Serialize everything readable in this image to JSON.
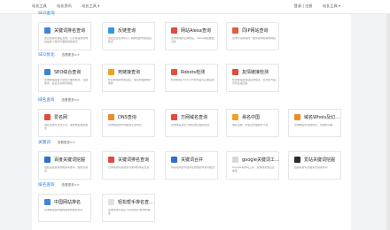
{
  "nav": {
    "left": [
      "站长工具",
      "站长资讯",
      "站长工具 ▾"
    ],
    "right": [
      "登录 | 注册",
      "站长工具 ▾"
    ]
  },
  "more_label": "查看更多>>",
  "sections": [
    {
      "title": "SEO查询",
      "cards": [
        {
          "name": "关键词排名查询",
          "desc": "通过关键词排名查询，可以快速找到网站在各个搜索引擎的排名情况",
          "color": "#3d86d8"
        },
        {
          "name": "反链查询",
          "desc": "通过反链查询可以了解网站的外部链接情况",
          "color": "#2f9ae0"
        },
        {
          "name": "网站Alexa查询",
          "desc": "查询网站的全球排名，Alexa排名数据分析",
          "color": "#e04a3a"
        },
        {
          "name": "同IP网站查询",
          "desc": "查询与该网站同一服务器IP的其他网站",
          "color": "#e45a3e"
        }
      ]
    },
    {
      "title": "SEO优化",
      "cards": [
        {
          "name": "SEO综合查询",
          "desc": "查询网站在各大搜索引擎的信息，包括收录、反链及关键词排名",
          "color": "#3b82d6"
        },
        {
          "name": "死链接查询",
          "desc": "检查网站中的死链接，提高网站的用户体验",
          "color": "#f0a020"
        },
        {
          "name": "Robots检测",
          "desc": "检测网站robots.txt文件是否正确设置",
          "color": "#e0503a"
        },
        {
          "name": "友情链接检测",
          "desc": "检测网站友情链接的情况，查询对方是否有链接回来",
          "color": "#e24a3c"
        }
      ]
    },
    {
      "title": "域名查询",
      "cards": [
        {
          "name": "爱名网",
          "desc": "域名注册及交易平台，提供域名相关服务",
          "color": "#e04a3a"
        },
        {
          "name": "DNS查询",
          "desc": "查询域名的DNS解析记录信息",
          "color": "#f08a24"
        },
        {
          "name": "万网域名查询",
          "desc": "查询域名是否已被注册及相关信息",
          "color": "#e24a3c"
        },
        {
          "name": "易名中国",
          "desc": "域名注册、交易及管理服务平台",
          "color": "#f0a020"
        },
        {
          "name": "域名Whois及幻...",
          "desc": "查询域名的注册信息、到期时间等",
          "color": "#f08a24"
        }
      ]
    },
    {
      "title": "关键词",
      "cards": [
        {
          "name": "百度关键词挖掘",
          "desc": "挖掘百度搜索的相关关键词，提供长尾词",
          "color": "#2f6fd0"
        },
        {
          "name": "关键词排名查询",
          "desc": "查询关键词在搜索引擎中的排名位置",
          "color": "#e04a3a"
        },
        {
          "name": "关键词合并",
          "desc": "将多组关键词合并生成新的关键词组合",
          "color": "#2f6fd0"
        },
        {
          "name": "google关键词工...",
          "desc": "Google关键词工具，查询搜索量及竞争度",
          "color": "#d8d8d8"
        },
        {
          "name": "爱站关键词挖掘",
          "desc": "挖掘关键词及相关长尾关键词",
          "color": "#2b2b2b"
        }
      ]
    },
    {
      "title": "排名查询",
      "cards": [
        {
          "name": "中国网站排名",
          "desc": "查询网站在中国网站中的排名情况",
          "color": "#3d86d8"
        },
        {
          "name": "轻松帮手排名查...",
          "desc": "查询关键词在google搜索引擎中的排名",
          "color": "#e0e0e0"
        }
      ]
    }
  ]
}
